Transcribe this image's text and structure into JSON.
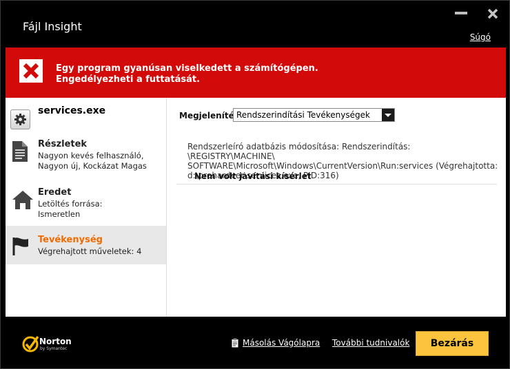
{
  "window": {
    "title": "Fájl Insight",
    "help_link": "Súgó"
  },
  "alert": {
    "line1": "Egy program gyanúsan viselkedett a számítógépen.",
    "line2": "Engedélyezheti a futtatását."
  },
  "sidebar": {
    "file_name": "services.exe",
    "items": [
      {
        "label": "Részletek",
        "sub1": "Nagyon kevés felhasználó,",
        "sub2": "Nagyon új,  Kockázat Magas"
      },
      {
        "label": "Eredet",
        "sub1": "Letöltés forrása:",
        "sub2": "Ismeretlen"
      },
      {
        "label": "Tevékenység",
        "sub1": "Végrehajtott műveletek: 4",
        "sub2": ""
      }
    ]
  },
  "main": {
    "show_label": "Megjelenítés",
    "show_value": "Rendszerindítási Tevékenységek",
    "entry": {
      "line1": "Rendszerleíró adatbázis módosítása: Rendszerindítás: \\REGISTRY\\MACHINE\\",
      "line2": "SOFTWARE\\Microsoft\\Windows\\CurrentVersion\\Run:services (Végrehajtotta:",
      "line3": "d:\\prohardver\\services.exe, PID:316)",
      "status": "Nem volt javítási kísérlet"
    }
  },
  "footer": {
    "brand": "Norton",
    "brand_sub": "by Symantec",
    "copy_label": "Másolás Vágólapra",
    "more_label": "További tudnivalók",
    "close_label": "Bezárás"
  },
  "colors": {
    "alert_red": "#d20a0a",
    "active_orange": "#ef6b00",
    "button_yellow": "#fcc33c"
  }
}
